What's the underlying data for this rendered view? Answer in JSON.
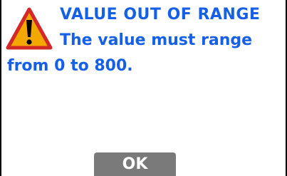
{
  "dialog": {
    "title": "VALUE OUT OF RANGE",
    "message_line1": "The value must range",
    "message_line2": "from 0 to 800.",
    "icon": "warning-icon",
    "ok_label": "OK"
  },
  "colors": {
    "text": "#1560e6",
    "warning_fill": "#f2a800",
    "warning_outline": "#d32828",
    "button": "#7a7a7a",
    "background": "#ffffff",
    "border": "#000000"
  }
}
